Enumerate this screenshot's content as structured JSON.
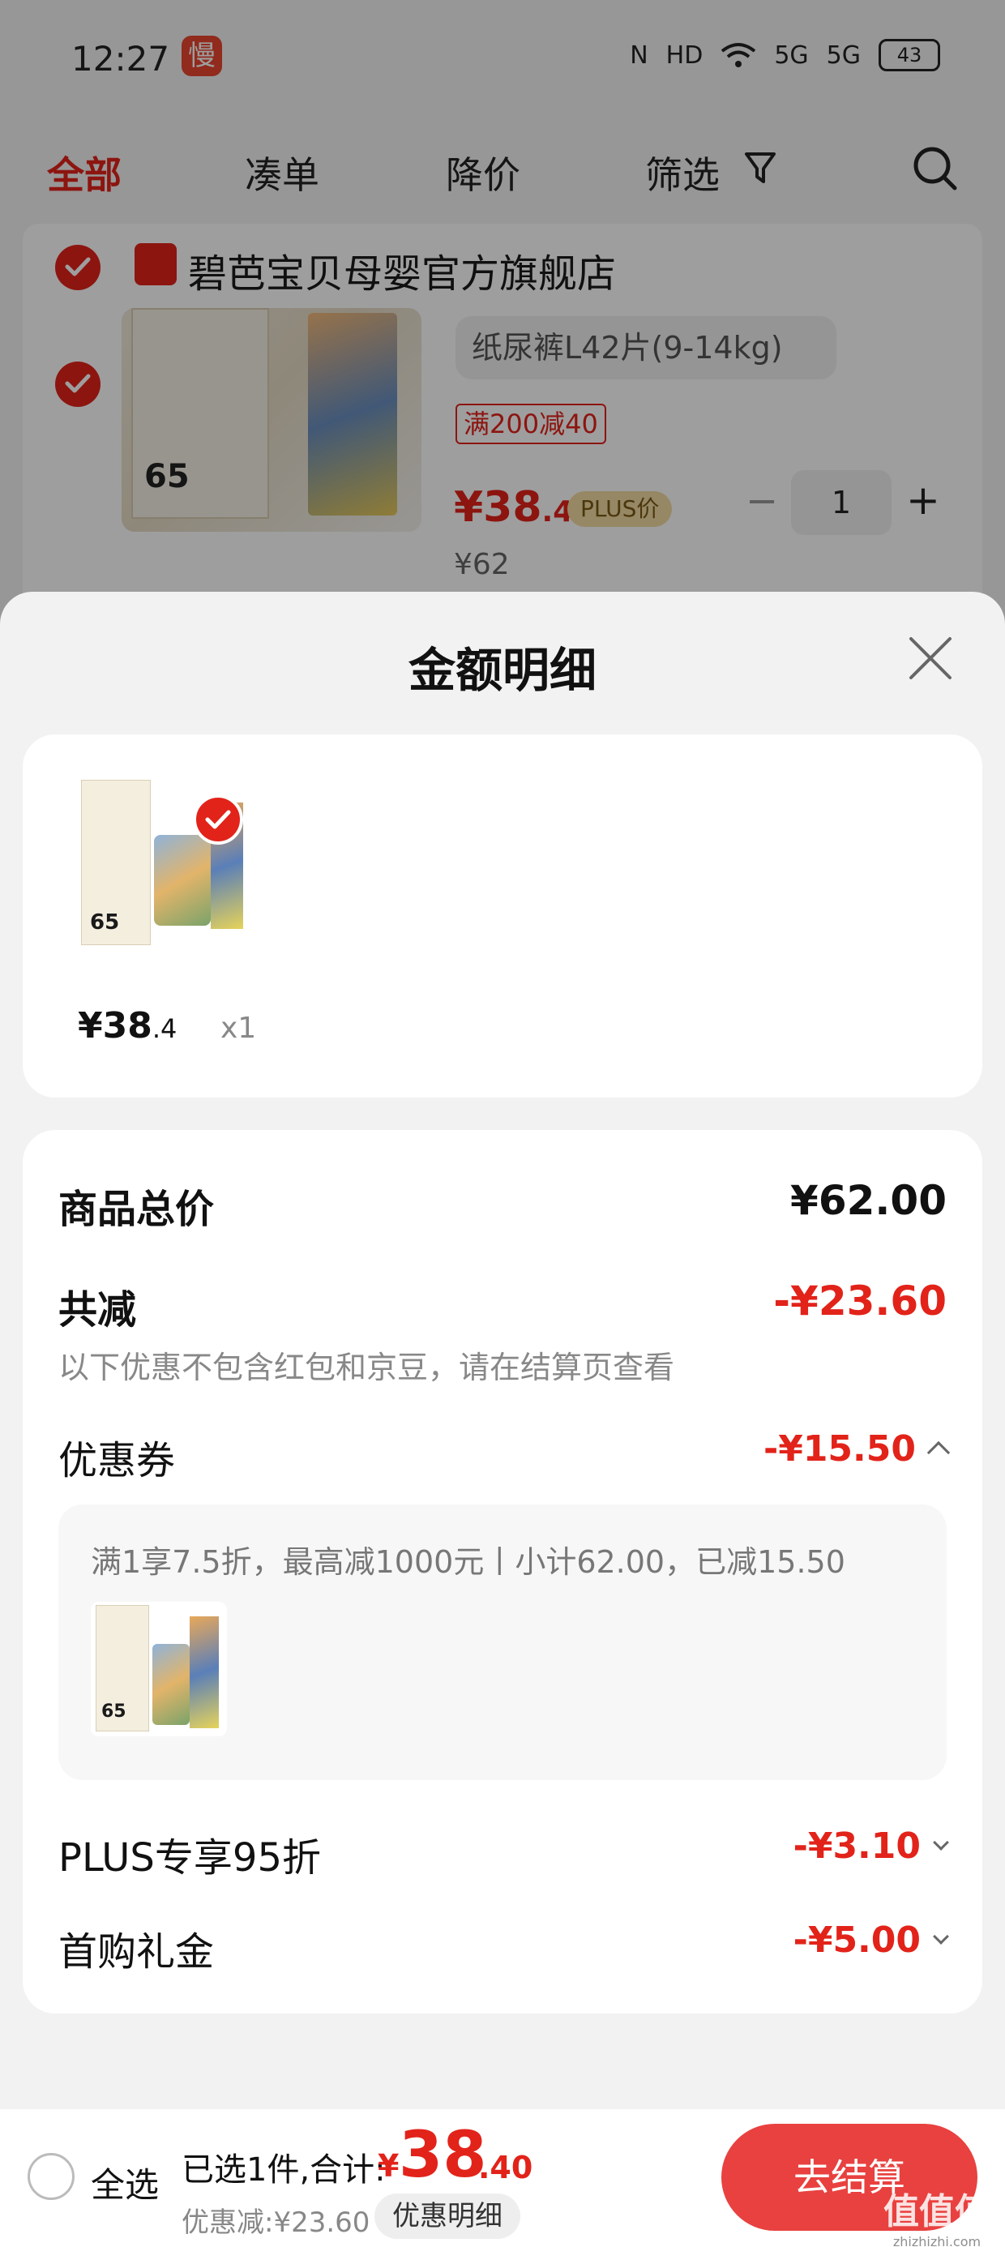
{
  "status_bar": {
    "time": "12:27",
    "app_badge": "慢",
    "network": "5G",
    "network2": "5G",
    "battery": "43"
  },
  "tabs": [
    {
      "label": "全部",
      "active": true
    },
    {
      "label": "凑单"
    },
    {
      "label": "降价"
    },
    {
      "label": "筛选"
    }
  ],
  "store": {
    "name": "碧芭宝贝母婴官方旗舰店",
    "product": {
      "image_number": "65",
      "variant": "纸尿裤L42片(9-14kg)",
      "promo": "满200减40",
      "price_main": "¥38",
      "price_dec": ".4",
      "plus_tag": "PLUS价",
      "orig_price": "¥62",
      "quantity": "1"
    }
  },
  "sheet": {
    "title": "金额明细",
    "item": {
      "price_main": "¥38",
      "price_dec": ".4",
      "qty": "x1",
      "image_number": "65"
    },
    "total_label": "商品总价",
    "total_value": "¥62.00",
    "discount_label": "共减",
    "discount_value": "-¥23.60",
    "discount_note": "以下优惠不包含红包和京豆，请在结算页查看",
    "coupon_label": "优惠券",
    "coupon_value": "-¥15.50",
    "coupon_detail": "满1享7.5折，最高减1000元丨小计62.00，已减15.50",
    "plus_label": "PLUS专享95折",
    "plus_value": "-¥3.10",
    "firstbuy_label": "首购礼金",
    "firstbuy_value": "-¥5.00"
  },
  "bottom": {
    "select_all": "全选",
    "summary": "已选1件,合计:",
    "currency": "¥",
    "total_main": "38",
    "total_dec": ".40",
    "saved": "优惠减:¥23.60",
    "detail_button": "优惠明细",
    "checkout": "去结算"
  },
  "watermark": {
    "text": "值值值",
    "sub": "zhizhizhi.com"
  },
  "colors": {
    "accent": "#e2231a",
    "checkout": "#e8413f"
  }
}
